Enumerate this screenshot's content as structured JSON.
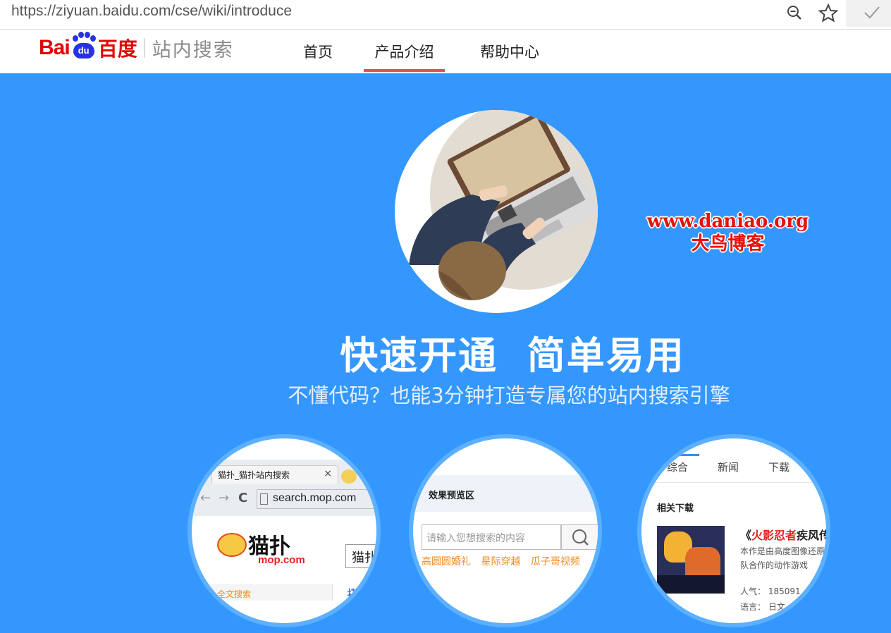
{
  "browser": {
    "url": "https://ziyuan.baidu.com/cse/wiki/introduce",
    "icons": [
      "zoom-icon",
      "star-icon",
      "check-icon"
    ]
  },
  "header": {
    "logo_bai": "Bai",
    "logo_du": "du",
    "logo_cn": "百度",
    "logo_sub": "站内搜索",
    "nav": [
      {
        "label": "首页",
        "active": false
      },
      {
        "label": "产品介绍",
        "active": true
      },
      {
        "label": "帮助中心",
        "active": false
      }
    ]
  },
  "watermark": {
    "line1": "www.daniao.org",
    "line2": "大鸟博客"
  },
  "hero": {
    "headline": "快速开通  简单易用",
    "subline": "不懂代码？也能3分钟打造专属您的站内搜索引擎"
  },
  "card1": {
    "tab_title": "猫扑_猫扑站内搜索",
    "address": "search.mop.com",
    "logo_text": "猫扑",
    "logo_domain": "mop.com",
    "search_value": "猫扑",
    "left_link": "全文搜索",
    "right_char": "搭"
  },
  "card2": {
    "bar_title": "效果预览区",
    "placeholder": "请输入您想搜索的内容",
    "links": [
      "高圆圆婚礼",
      "星际穿越",
      "瓜子哥视频"
    ]
  },
  "card3": {
    "tabs": [
      "综合",
      "新闻",
      "下载"
    ],
    "section": "相关下载",
    "title_prefix": "《",
    "title_red": "火影忍者",
    "title_rest": "疾风传",
    "desc": "本作是由高度图像还原团队合作的动作游戏",
    "meta_pop": "人气：  185091",
    "meta_lang": "语言：  日文"
  },
  "colors": {
    "hero_bg": "#3497fd",
    "brand_red": "#e10602",
    "brand_blue": "#2932e1",
    "nav_active": "#e55050"
  }
}
